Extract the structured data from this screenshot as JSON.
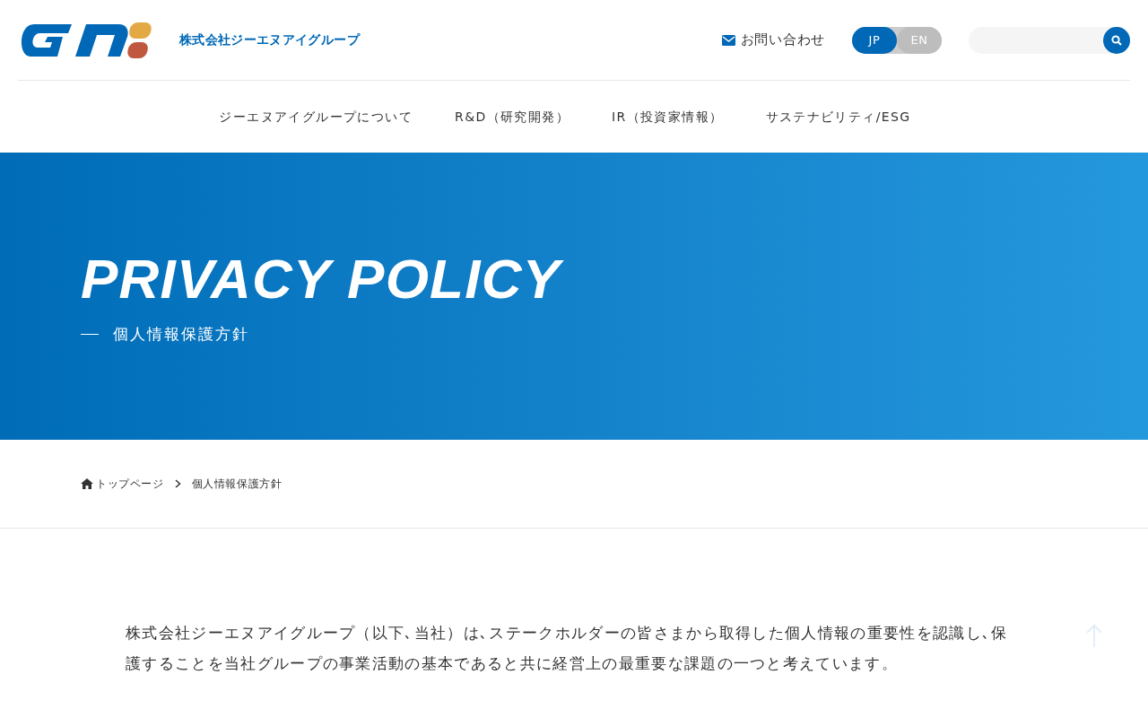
{
  "header": {
    "company": "株式会社ジーエヌアイグループ",
    "contact": "お問い合わせ",
    "languages": [
      {
        "label": "JP",
        "selected": true
      },
      {
        "label": "EN",
        "selected": false
      }
    ]
  },
  "nav": [
    "ジーエヌアイグループについて",
    "R&D（研究開発）",
    "IR（投資家情報）",
    "サステナビリティ/ESG"
  ],
  "hero": {
    "title": "PRIVACY POLICY",
    "subtitle": "個人情報保護方針"
  },
  "breadcrumb": [
    "トップページ",
    "個人情報保護方針"
  ],
  "intro": "株式会社ジーエヌアイグループ（以下､当社）は､ステークホルダーの皆さまから取得した個人情報の重要性を認識し､保護することを当社グループの事業活動の基本であると共に経営上の最重要な課題の一つと考えています。"
}
